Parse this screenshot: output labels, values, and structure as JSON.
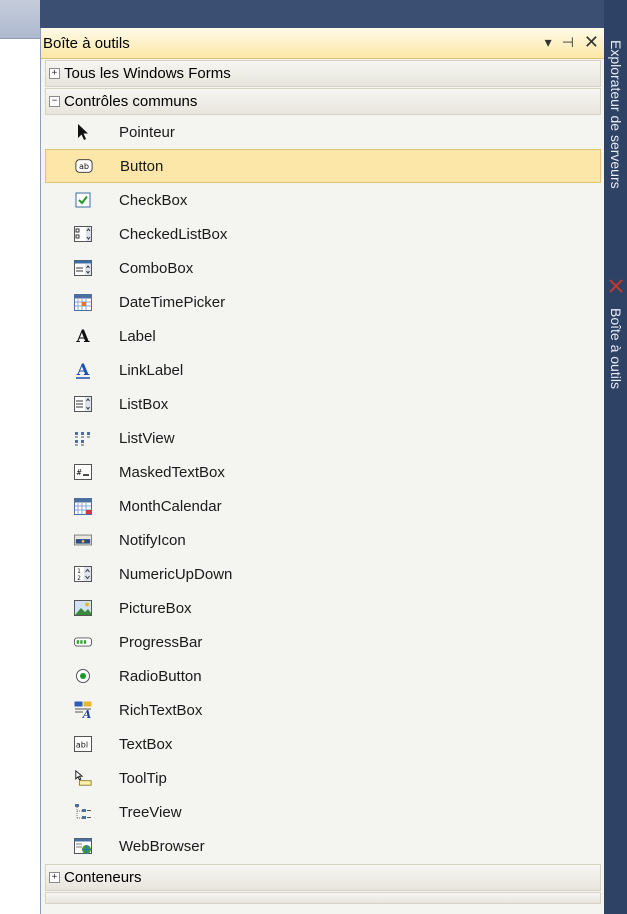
{
  "toolbox": {
    "title": "Boîte à outils",
    "buttons": {
      "dropdown": "▾",
      "pin": "⊣",
      "close": "✕"
    },
    "groups": [
      {
        "label": "Tous les Windows Forms",
        "expander": "+"
      },
      {
        "label": "Contrôles communs",
        "expander": "−"
      }
    ],
    "items": [
      {
        "label": "Pointeur",
        "icon": "pointer-icon"
      },
      {
        "label": "Button",
        "icon": "button-icon"
      },
      {
        "label": "CheckBox",
        "icon": "checkbox-icon"
      },
      {
        "label": "CheckedListBox",
        "icon": "checkedlistbox-icon"
      },
      {
        "label": "ComboBox",
        "icon": "combobox-icon"
      },
      {
        "label": "DateTimePicker",
        "icon": "datetimepicker-icon"
      },
      {
        "label": "Label",
        "icon": "label-icon"
      },
      {
        "label": "LinkLabel",
        "icon": "linklabel-icon"
      },
      {
        "label": "ListBox",
        "icon": "listbox-icon"
      },
      {
        "label": "ListView",
        "icon": "listview-icon"
      },
      {
        "label": "MaskedTextBox",
        "icon": "maskedtextbox-icon"
      },
      {
        "label": "MonthCalendar",
        "icon": "monthcalendar-icon"
      },
      {
        "label": "NotifyIcon",
        "icon": "notifyicon-icon"
      },
      {
        "label": "NumericUpDown",
        "icon": "numericupdown-icon"
      },
      {
        "label": "PictureBox",
        "icon": "picturebox-icon"
      },
      {
        "label": "ProgressBar",
        "icon": "progressbar-icon"
      },
      {
        "label": "RadioButton",
        "icon": "radiobutton-icon"
      },
      {
        "label": "RichTextBox",
        "icon": "richtextbox-icon"
      },
      {
        "label": "TextBox",
        "icon": "textbox-icon"
      },
      {
        "label": "ToolTip",
        "icon": "tooltip-icon"
      },
      {
        "label": "TreeView",
        "icon": "treeview-icon"
      },
      {
        "label": "WebBrowser",
        "icon": "webbrowser-icon"
      }
    ],
    "footer_group": {
      "label": "Conteneurs",
      "expander": "+"
    }
  },
  "sidebar": {
    "tabs": [
      {
        "label": "Explorateur de serveurs"
      },
      {
        "label": "Boîte à outils"
      }
    ]
  },
  "colors": {
    "selected_bg": "#fce6a8",
    "title_bg": "#fbe7a6",
    "sidebar_bg": "#2e4266"
  }
}
